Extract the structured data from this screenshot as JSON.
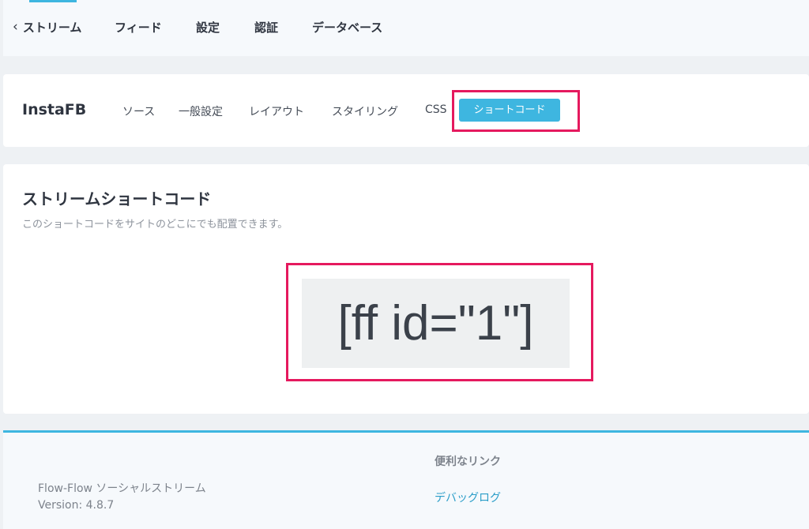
{
  "topnav": {
    "back_icon": "chevron-left-icon",
    "items": [
      {
        "label": "ストリーム"
      },
      {
        "label": "フィード"
      },
      {
        "label": "設定"
      },
      {
        "label": "認証"
      },
      {
        "label": "データベース"
      }
    ],
    "accent_color": "#3eb6e0"
  },
  "stream": {
    "title": "InstaFB",
    "tabs": [
      {
        "label": "ソース"
      },
      {
        "label": "一般設定"
      },
      {
        "label": "レイアウト"
      },
      {
        "label": "スタイリング"
      },
      {
        "label": "CSS"
      },
      {
        "label": "ショートコード",
        "active": true
      }
    ],
    "active_tab_color": "#3eb6e0",
    "highlight_color": "#e5195e"
  },
  "shortcode": {
    "title": "ストリームショートコード",
    "description": "このショートコードをサイトのどこにでも配置できます。",
    "code": "[ff id=\"1\"]"
  },
  "footer": {
    "product_name": "Flow-Flow ソーシャルストリーム",
    "version": "Version: 4.8.7",
    "links_heading": "便利なリンク",
    "links": [
      {
        "label": "デバッグログ"
      }
    ]
  }
}
